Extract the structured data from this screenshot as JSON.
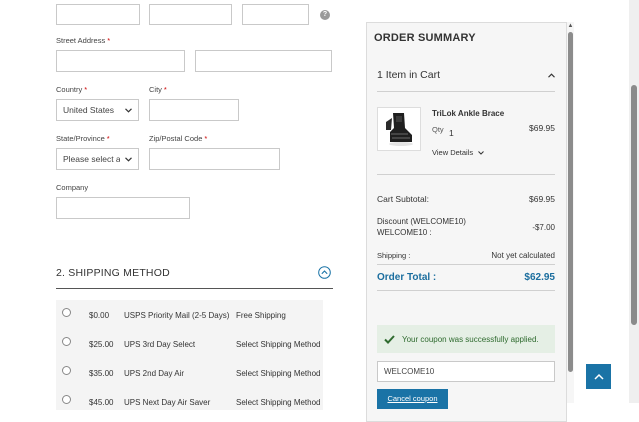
{
  "address": {
    "street_label": "Street Address",
    "country_label": "Country",
    "country_value": "United States",
    "city_label": "City",
    "state_label": "State/Province",
    "state_placeholder": "Please select a region, state or province.",
    "zip_label": "Zip/Postal Code",
    "company_label": "Company",
    "required_mark": "*",
    "help_glyph": "?"
  },
  "shipping": {
    "section_title": "2. SHIPPING METHOD",
    "options": [
      {
        "price": "$0.00",
        "method": "USPS Priority Mail (2-5 Days)",
        "carrier": "Free Shipping"
      },
      {
        "price": "$25.00",
        "method": "UPS 3rd Day Select",
        "carrier": "Select Shipping Method"
      },
      {
        "price": "$35.00",
        "method": "UPS 2nd Day Air",
        "carrier": "Select Shipping Method"
      },
      {
        "price": "$45.00",
        "method": "UPS Next Day Air Saver",
        "carrier": "Select Shipping Method"
      }
    ]
  },
  "summary": {
    "title": "ORDER SUMMARY",
    "items_in_cart": "1 Item in Cart",
    "product_name": "TriLok Ankle Brace",
    "qty_label": "Qty",
    "qty_value": "1",
    "product_price": "$69.95",
    "view_details": "View Details",
    "subtotal_label": "Cart Subtotal:",
    "subtotal_value": "$69.95",
    "discount_label_1": "Discount (WELCOME10)",
    "discount_label_2": "WELCOME10 :",
    "discount_value": "-$7.00",
    "shipping_label": "Shipping :",
    "shipping_value": "Not yet calculated",
    "total_label": "Order Total :",
    "total_value": "$62.95",
    "coupon_message": "Your coupon was successfully applied.",
    "coupon_code": "WELCOME10",
    "cancel_coupon": "Cancel coupon"
  },
  "colors": {
    "accent": "#1a73a6",
    "success_bg": "#e5efe5",
    "success_text": "#2f6b2f",
    "total_blue": "#1a6d9e"
  }
}
